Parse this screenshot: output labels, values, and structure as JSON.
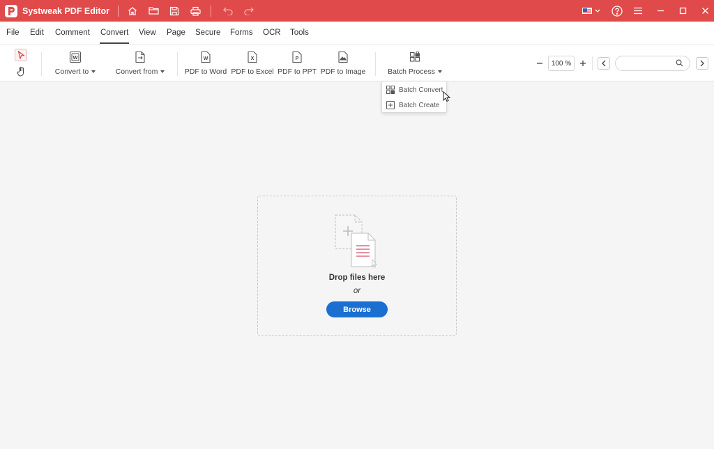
{
  "app": {
    "title": "Systweak PDF Editor",
    "accent_color": "#e04a4a"
  },
  "titlebar_icons": [
    "home-icon",
    "folder-open-icon",
    "save-icon",
    "print-icon",
    "undo-icon",
    "redo-icon"
  ],
  "titlebar_right": [
    "us-flag-icon",
    "help-icon",
    "hamburger-menu-icon",
    "minimize-icon",
    "maximize-icon",
    "close-icon"
  ],
  "menu": [
    {
      "label": "File"
    },
    {
      "label": "Edit"
    },
    {
      "label": "Comment"
    },
    {
      "label": "Convert",
      "active": true
    },
    {
      "label": "View"
    },
    {
      "label": "Page"
    },
    {
      "label": "Secure"
    },
    {
      "label": "Forms"
    },
    {
      "label": "OCR"
    },
    {
      "label": "Tools"
    }
  ],
  "toolbar": {
    "convert_to": "Convert to",
    "convert_from": "Convert from",
    "pdf_to_word": "PDF to Word",
    "pdf_to_excel": "PDF to Excel",
    "pdf_to_ppt": "PDF to PPT",
    "pdf_to_image": "PDF to Image",
    "batch_process": "Batch Process",
    "zoom": "100 %",
    "search_value": ""
  },
  "batch_menu": {
    "items": [
      {
        "label": "Batch Convert",
        "icon": "batch-convert-icon"
      },
      {
        "label": "Batch Create",
        "icon": "plus-box-icon"
      }
    ]
  },
  "dropzone": {
    "title": "Drop files here",
    "or": "or",
    "browse": "Browse",
    "button_color": "#1a6fd1"
  }
}
